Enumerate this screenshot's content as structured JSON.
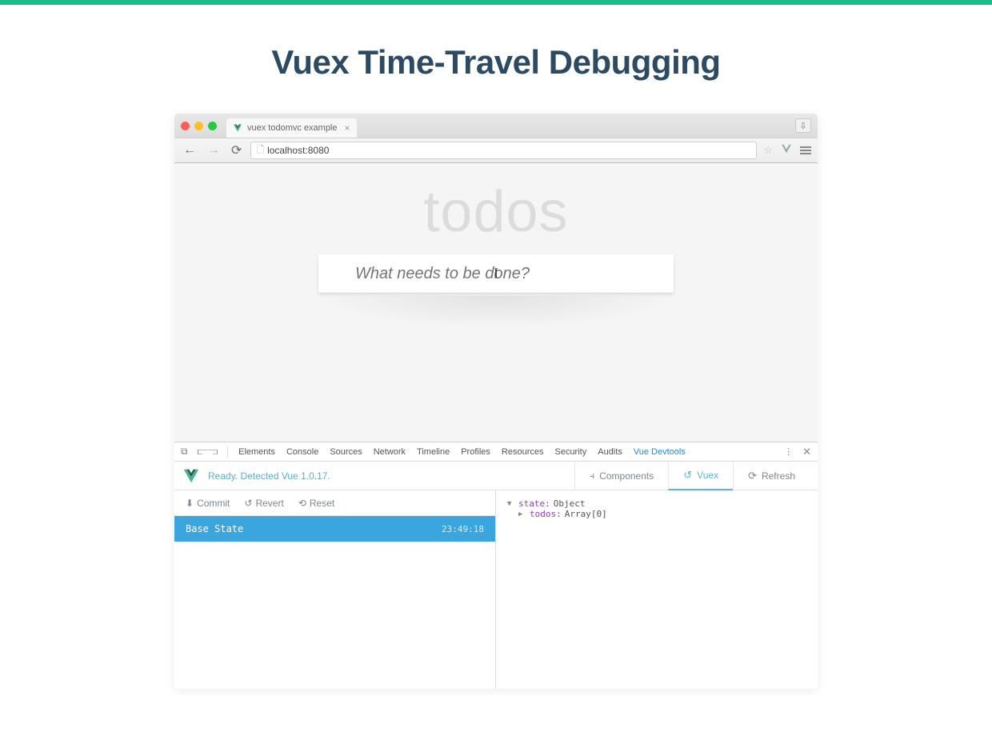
{
  "title": "Vuex Time-Travel Debugging",
  "browser": {
    "tab_title": "vuex todomvc example",
    "url": "localhost:8080"
  },
  "app": {
    "heading": "todos",
    "input_placeholder": "What needs to be done?",
    "cursor": "I"
  },
  "devtools": {
    "tabs": [
      "Elements",
      "Console",
      "Sources",
      "Network",
      "Timeline",
      "Profiles",
      "Resources",
      "Security",
      "Audits",
      "Vue Devtools"
    ],
    "active_tab": "Vue Devtools"
  },
  "vue": {
    "status": "Ready. Detected Vue 1.0.17.",
    "sections": {
      "components": "Components",
      "vuex": "Vuex",
      "refresh": "Refresh"
    },
    "toolbar": {
      "commit": "Commit",
      "revert": "Revert",
      "reset": "Reset"
    },
    "base_state_label": "Base State",
    "base_state_time": "23:49:18",
    "state": {
      "line1_key": "state:",
      "line1_val": "Object",
      "line2_key": "todos:",
      "line2_val": "Array[0]"
    }
  }
}
